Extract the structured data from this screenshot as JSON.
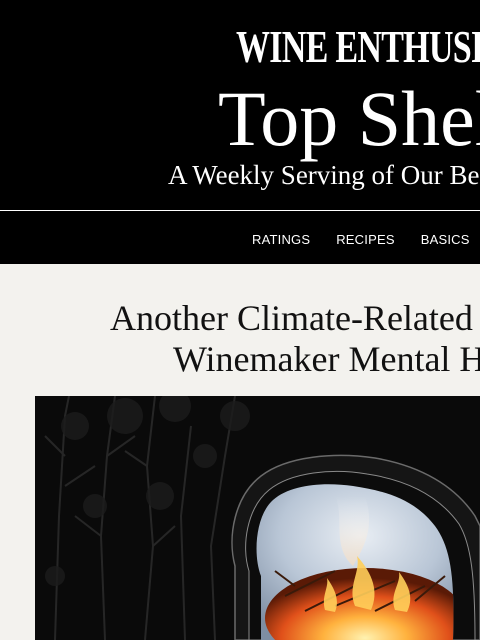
{
  "header": {
    "brand": "WINE ENTHUSIAST",
    "newsletter_title": "Top Shel",
    "tagline": "A Weekly Serving of Our Bes"
  },
  "nav": {
    "items": [
      "RATINGS",
      "RECIPES",
      "BASICS"
    ]
  },
  "article": {
    "headline_line1": "Another Climate-Related I",
    "headline_line2": "Winemaker Mental He",
    "hero_image": "collage of dark forest with a head silhouette framing a burning brush fire"
  },
  "colors": {
    "masthead_bg": "#000000",
    "page_bg": "#f3f2ee",
    "headline_text": "#111111"
  }
}
